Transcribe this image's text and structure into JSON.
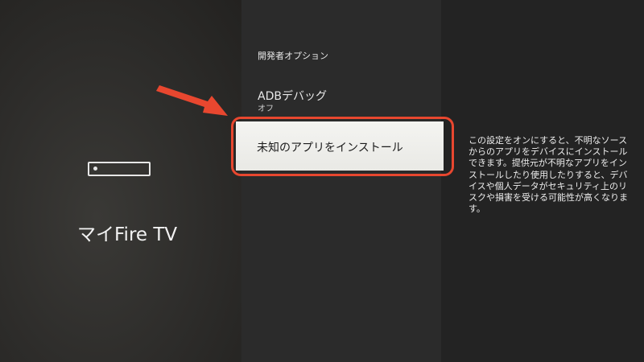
{
  "left_panel": {
    "device_icon": "fire-tv-device-icon",
    "device_name": "マイFire TV"
  },
  "menu": {
    "section_title": "開発者オプション",
    "items": [
      {
        "label": "ADBデバッグ",
        "sub": "オフ"
      },
      {
        "label": "未知のアプリをインストール",
        "selected": true
      }
    ]
  },
  "description": "この設定をオンにすると、不明なソースからのアプリをデバイスにインストールできます。提供元が不明なアプリをインストールしたり使用したりすると、デバイスや個人データがセキュリティ上のリスクや損害を受ける可能性が高くなります。",
  "annotation": {
    "arrow_icon": "red-arrow-icon",
    "accent_color": "#e8472f"
  },
  "colors": {
    "selected_bg": "#f0f0ed",
    "text_light": "#e8e8e8"
  }
}
